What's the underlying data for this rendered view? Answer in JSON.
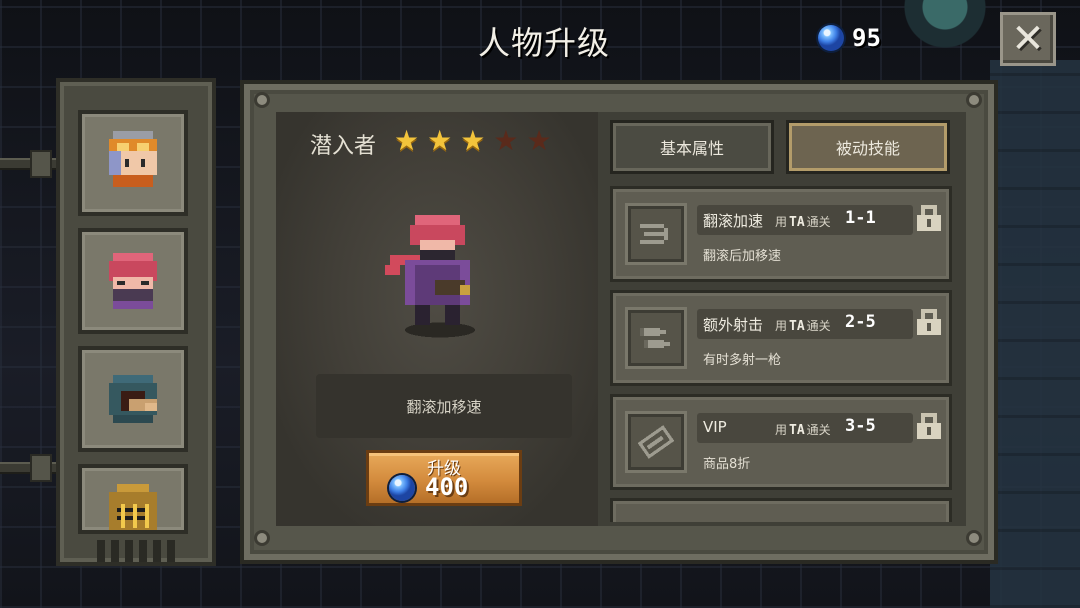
{
  "header": {
    "title": "人物升级",
    "gem_count": "95",
    "close_label": "✕"
  },
  "character_list": [
    {
      "name": "goggles-hero"
    },
    {
      "name": "infiltrator"
    },
    {
      "name": "hooded-plague-doctor"
    },
    {
      "name": "armored-knight"
    }
  ],
  "character": {
    "name": "潜入者",
    "stars_filled": 3,
    "stars_total": 5,
    "stars": [
      "★",
      "★",
      "★",
      "★",
      "★"
    ],
    "selected_skill_desc": "翻滚加移速",
    "upgrade": {
      "label": "升级",
      "cost": "400"
    }
  },
  "tabs": [
    {
      "label": "基本属性",
      "active": false
    },
    {
      "label": "被动技能",
      "active": true
    }
  ],
  "skills": [
    {
      "name": "翻滚加速",
      "req_prefix": "用",
      "req_char": "TA",
      "req_suffix": "通关",
      "stage": "1-1",
      "effect": "翻滚后加移速",
      "icon": "wind-dash-icon",
      "locked": true
    },
    {
      "name": "额外射击",
      "req_prefix": "用",
      "req_char": "TA",
      "req_suffix": "通关",
      "stage": "2-5",
      "effect": "有时多射一枪",
      "icon": "bullets-icon",
      "locked": true
    },
    {
      "name": "VIP",
      "req_prefix": "用",
      "req_char": "TA",
      "req_suffix": "通关",
      "stage": "3-5",
      "effect": "商品8折",
      "icon": "vip-ticket-icon",
      "locked": true
    }
  ],
  "colors": {
    "accent_orange": "#d38b3d",
    "star_on": "#f3c43b",
    "star_off": "#5a2a1b",
    "panel": "#56564b"
  }
}
